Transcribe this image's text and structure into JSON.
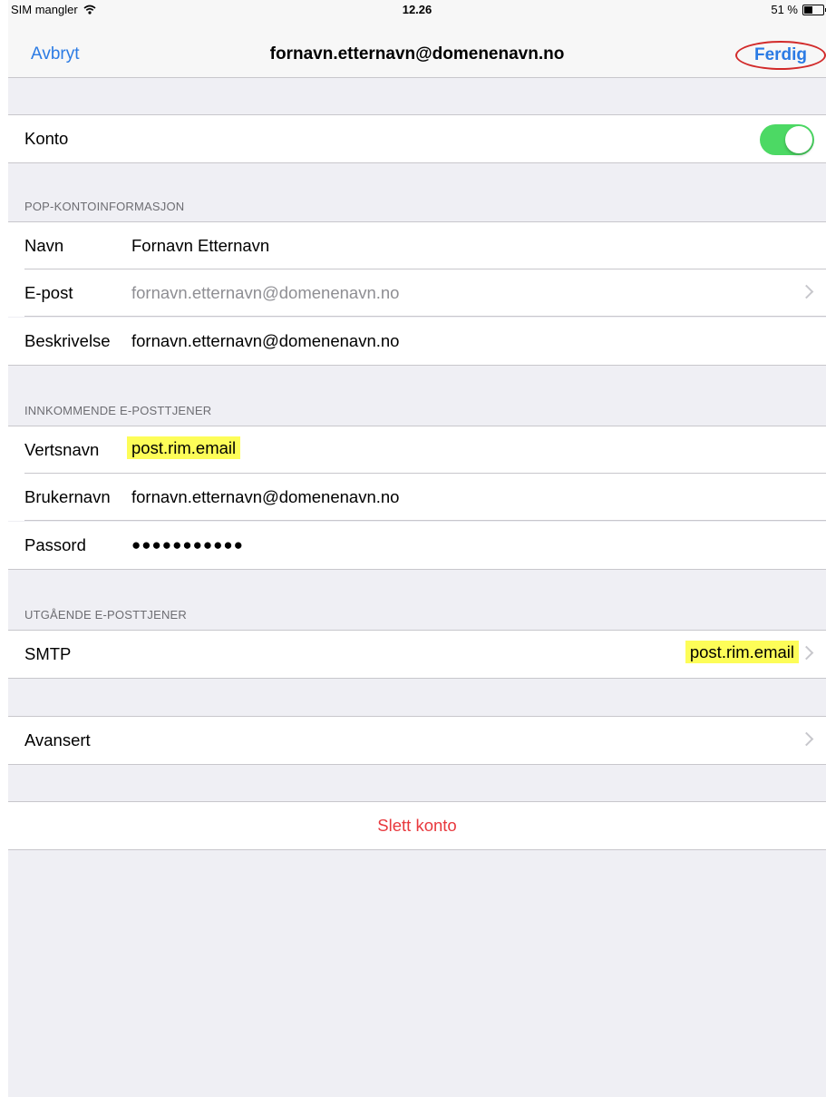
{
  "status": {
    "carrier": "SIM mangler",
    "time": "12.26",
    "battery": "51 %",
    "battery_level": 0.51
  },
  "nav": {
    "cancel": "Avbryt",
    "title": "fornavn.etternavn@domenenavn.no",
    "done": "Ferdig"
  },
  "account": {
    "label": "Konto",
    "enabled": true
  },
  "pop_section": {
    "header": "POP-KONTOINFORMASJON",
    "name_label": "Navn",
    "name_value": "Fornavn Etternavn",
    "email_label": "E-post",
    "email_value": "fornavn.etternavn@domenenavn.no",
    "desc_label": "Beskrivelse",
    "desc_value": "fornavn.etternavn@domenenavn.no"
  },
  "incoming": {
    "header": "INNKOMMENDE E-POSTTJENER",
    "host_label": "Vertsnavn",
    "host_value": "post.rim.email",
    "user_label": "Brukernavn",
    "user_value": "fornavn.etternavn@domenenavn.no",
    "pass_label": "Passord",
    "pass_value": "●●●●●●●●●●●"
  },
  "outgoing": {
    "header": "UTGÅENDE E-POSTTJENER",
    "smtp_label": "SMTP",
    "smtp_value": "post.rim.email"
  },
  "advanced": {
    "label": "Avansert"
  },
  "delete": {
    "label": "Slett konto"
  },
  "colors": {
    "accent": "#2b7be4",
    "toggle_on": "#4cd964",
    "destructive": "#e8383d",
    "highlight": "#fdfd58",
    "annotation": "#d22a2a"
  }
}
